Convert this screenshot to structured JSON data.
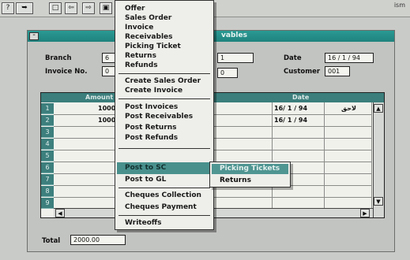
{
  "toolbar": {
    "buttons": [
      "?",
      "➥",
      "□",
      "⇦",
      "⇨",
      "▣"
    ],
    "menu_label": "ism"
  },
  "window": {
    "title": "vables",
    "branch_label": "Branch",
    "branch_value": "6",
    "invoice_label": "Invoice No.",
    "invoice_value": "0",
    "field1_value": "1",
    "field2_value": "0",
    "date_label": "Date",
    "date_value": "16 / 1  / 94",
    "customer_label": "Customer",
    "customer_value": "001",
    "total_label": "Total",
    "total_value": "2000.00"
  },
  "grid": {
    "headers": [
      "Amount",
      "Date"
    ],
    "row_numbers": [
      "1",
      "2",
      "3",
      "4",
      "5",
      "6",
      "7",
      "8",
      "9"
    ],
    "rows": [
      {
        "amount": "1000",
        "date": "16/ 1  / 94",
        "note": "لاحق"
      },
      {
        "amount": "1000",
        "date": "16/ 1  / 94",
        "note": ""
      }
    ]
  },
  "menu": {
    "items": [
      "Offer",
      "Sales Order",
      "Invoice",
      "Receivables",
      "Picking Ticket",
      "Returns",
      "Refunds",
      "Create Sales Order",
      "Create Invoice",
      "Post Invoices",
      "Post Receivables",
      "Post Returns",
      "Post Refunds",
      "Post to SC",
      "Post to GL",
      "Cheques Collection",
      "Cheques Payment",
      "Writeoffs"
    ]
  },
  "submenu": {
    "items": [
      "Picking Tickets",
      "Returns"
    ]
  }
}
